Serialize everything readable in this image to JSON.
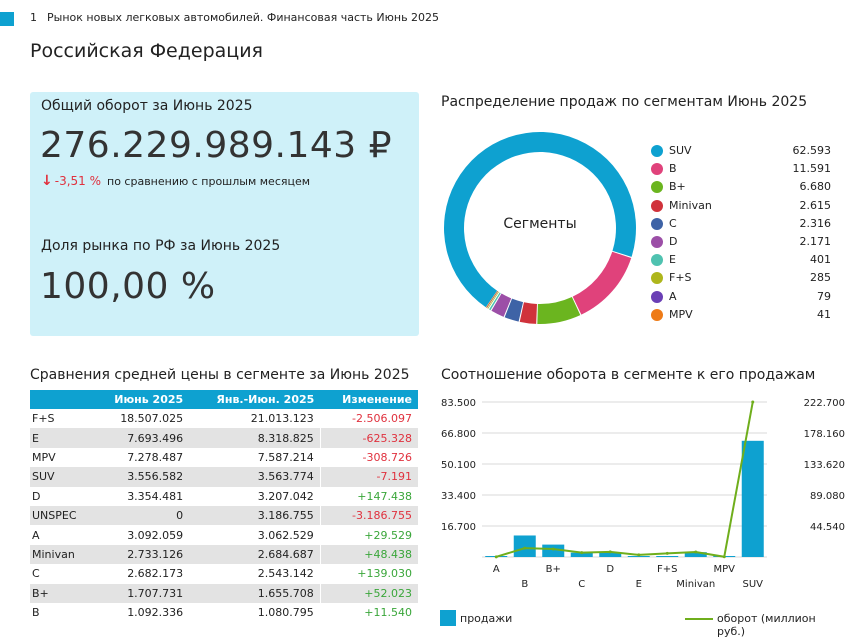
{
  "header": {
    "tab_number": "1",
    "tab_title": "Рынок новых легковых автомобилей. Финансовая часть Июнь 2025"
  },
  "page_title": "Российская Федерация",
  "colors": {
    "accent": "#0ea1d0",
    "card_bg": "#cff1f9",
    "negative": "#e0313e",
    "positive": "#3aa63a",
    "line": "#6fae1c"
  },
  "kpi": {
    "turnover_label": "Общий оборот за Июнь 2025",
    "turnover_value": "276.229.989.143 ₽",
    "change_arrow_icon": "arrow-down-icon",
    "change_pct": "-3,51 %",
    "change_desc": "по сравнению с прошлым месяцем",
    "share_label": "Доля рынка по РФ за Июнь 2025",
    "share_value": "100,00 %"
  },
  "donut": {
    "title": "Распределение продаж по сегментам Июнь 2025",
    "center_label": "Сегменты"
  },
  "table": {
    "title": "Сравнения средней цены в сегменте за Июнь 2025",
    "headers": [
      "",
      "Июнь 2025",
      "Янв.-Июн. 2025",
      "Изменение"
    ],
    "rows": [
      [
        "F+S",
        "18.507.025",
        "21.013.123",
        "-2.506.097"
      ],
      [
        "E",
        "7.693.496",
        "8.318.825",
        "-625.328"
      ],
      [
        "MPV",
        "7.278.487",
        "7.587.214",
        "-308.726"
      ],
      [
        "SUV",
        "3.556.582",
        "3.563.774",
        "-7.191"
      ],
      [
        "D",
        "3.354.481",
        "3.207.042",
        "+147.438"
      ],
      [
        "UNSPEC",
        "0",
        "3.186.755",
        "-3.186.755"
      ],
      [
        "A",
        "3.092.059",
        "3.062.529",
        "+29.529"
      ],
      [
        "Minivan",
        "2.733.126",
        "2.684.687",
        "+48.438"
      ],
      [
        "C",
        "2.682.173",
        "2.543.142",
        "+139.030"
      ],
      [
        "B+",
        "1.707.731",
        "1.655.708",
        "+52.023"
      ],
      [
        "B",
        "1.092.336",
        "1.080.795",
        "+11.540"
      ]
    ]
  },
  "combo": {
    "title": "Соотношение оборота в сегменте к его продажам",
    "legend_bar": "продажи",
    "legend_line": "оборот (миллион руб.)"
  },
  "chart_data": [
    {
      "type": "pie",
      "title": "Распределение продаж по сегментам Июнь 2025",
      "labels": [
        "SUV",
        "B",
        "B+",
        "Minivan",
        "C",
        "D",
        "E",
        "F+S",
        "A",
        "MPV"
      ],
      "values": [
        62593,
        11591,
        6680,
        2615,
        2316,
        2171,
        401,
        285,
        79,
        41
      ],
      "value_labels": [
        "62.593",
        "11.591",
        "6.680",
        "2.615",
        "2.316",
        "2.171",
        "401",
        "285",
        "79",
        "41"
      ],
      "colors": [
        "#0ea1d0",
        "#e0427b",
        "#6bb51f",
        "#d0323b",
        "#3e63a6",
        "#9c4fa7",
        "#4fc2b0",
        "#aeb61c",
        "#6a3fb5",
        "#ee7b17"
      ],
      "legend": "right"
    },
    {
      "type": "bar",
      "title": "Соотношение оборота в сегменте к его продажам",
      "categories": [
        "A",
        "B",
        "B+",
        "C",
        "D",
        "E",
        "F+S",
        "Minivan",
        "MPV",
        "SUV"
      ],
      "series": [
        {
          "name": "продажи",
          "type": "bar",
          "axis": "left",
          "values": [
            79,
            11591,
            6680,
            2316,
            2171,
            401,
            285,
            2615,
            41,
            62593
          ]
        },
        {
          "name": "оборот (миллион руб.)",
          "type": "line",
          "axis": "right",
          "values": [
            244,
            12662,
            11408,
            6212,
            7283,
            3085,
            5275,
            7147,
            298,
            222615
          ]
        }
      ],
      "y_left": {
        "ylim": [
          0,
          83500
        ],
        "ticks": [
          "16.700",
          "33.400",
          "50.100",
          "66.800",
          "83.500"
        ]
      },
      "y_right": {
        "ylim": [
          0,
          222700
        ],
        "ticks": [
          "44.540",
          "89.080",
          "133.620",
          "178.160",
          "222.700"
        ]
      },
      "legend": "bottom"
    }
  ]
}
